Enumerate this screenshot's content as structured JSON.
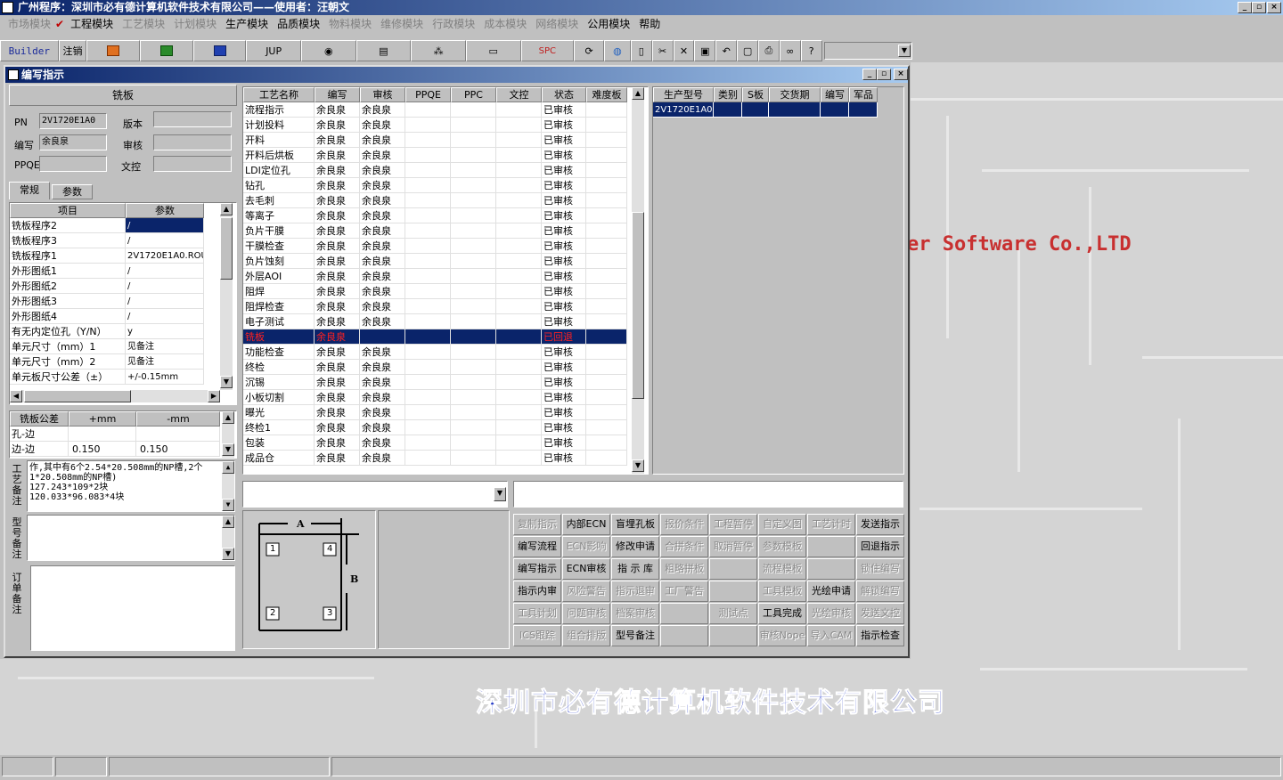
{
  "window": {
    "title": "广州程序：深圳市必有德计算机软件技术有限公司——使用者：汪朝文"
  },
  "menu": [
    {
      "label": "市场模块",
      "enabled": false
    },
    {
      "label": "工程模块",
      "enabled": true,
      "checked": true
    },
    {
      "label": "工艺模块",
      "enabled": false
    },
    {
      "label": "计划模块",
      "enabled": false
    },
    {
      "label": "生产模块",
      "enabled": true
    },
    {
      "label": "品质模块",
      "enabled": true
    },
    {
      "label": "物料模块",
      "enabled": false
    },
    {
      "label": "维修模块",
      "enabled": false
    },
    {
      "label": "行政模块",
      "enabled": false
    },
    {
      "label": "成本模块",
      "enabled": false
    },
    {
      "label": "网络模块",
      "enabled": false
    },
    {
      "label": "公用模块",
      "enabled": true
    },
    {
      "label": "帮助",
      "enabled": true
    }
  ],
  "toolbar": {
    "builder": "Builder",
    "logout": "注销",
    "jup": "JUP",
    "spc": "SPC"
  },
  "child": {
    "title": "编写指示"
  },
  "process": {
    "name": "铣板",
    "pn_label": "PN",
    "pn": "2V1720E1A0",
    "version_label": "版本",
    "version": "",
    "author_label": "编写",
    "author": "余良泉",
    "review_label": "审核",
    "review": "",
    "ppqe_label": "PPQE",
    "ppqe": "",
    "doc_label": "文控",
    "doc": ""
  },
  "tabs": [
    "常规",
    "参数"
  ],
  "params": {
    "headers": [
      "项目",
      "参数"
    ],
    "rows": [
      [
        "铣板程序2",
        "/"
      ],
      [
        "铣板程序3",
        "/"
      ],
      [
        "铣板程序1",
        "2V1720E1A0.ROU"
      ],
      [
        "外形图纸1",
        "/"
      ],
      [
        "外形图纸2",
        "/"
      ],
      [
        "外形图纸3",
        "/"
      ],
      [
        "外形图纸4",
        "/"
      ],
      [
        "有无内定位孔（Y/N）",
        "y"
      ],
      [
        "单元尺寸（mm）1",
        "见备注"
      ],
      [
        "单元尺寸（mm）2",
        "见备注"
      ],
      [
        "单元板尺寸公差（±）",
        "+/-0.15mm"
      ]
    ]
  },
  "tolerance": {
    "headers": [
      "铣板公差",
      "+mm",
      "-mm"
    ],
    "rows": [
      [
        "孔-边",
        "",
        ""
      ],
      [
        "边-边",
        "0.150",
        "0.150"
      ]
    ]
  },
  "notes": {
    "process_label": "工艺备注",
    "process_text": [
      "作,其中有6个2.54*20.508mm的NP槽,2个1*20.508mm的NP槽)",
      "127.243*109*2块",
      "120.033*96.083*4块"
    ],
    "model_label": "型号备注",
    "order_label": "订单备注"
  },
  "steps": {
    "headers": [
      "工艺名称",
      "编写",
      "审核",
      "PPQE",
      "PPC",
      "文控",
      "状态",
      "难度板"
    ],
    "rows": [
      [
        "流程指示",
        "余良泉",
        "余良泉",
        "",
        "",
        "",
        "已审核",
        ""
      ],
      [
        "计划投料",
        "余良泉",
        "余良泉",
        "",
        "",
        "",
        "已审核",
        ""
      ],
      [
        "开料",
        "余良泉",
        "余良泉",
        "",
        "",
        "",
        "已审核",
        ""
      ],
      [
        "开料后烘板",
        "余良泉",
        "余良泉",
        "",
        "",
        "",
        "已审核",
        ""
      ],
      [
        "LDI定位孔",
        "余良泉",
        "余良泉",
        "",
        "",
        "",
        "已审核",
        ""
      ],
      [
        "钻孔",
        "余良泉",
        "余良泉",
        "",
        "",
        "",
        "已审核",
        ""
      ],
      [
        "去毛刺",
        "余良泉",
        "余良泉",
        "",
        "",
        "",
        "已审核",
        ""
      ],
      [
        "等离子",
        "余良泉",
        "余良泉",
        "",
        "",
        "",
        "已审核",
        ""
      ],
      [
        "负片干膜",
        "余良泉",
        "余良泉",
        "",
        "",
        "",
        "已审核",
        ""
      ],
      [
        "干膜检查",
        "余良泉",
        "余良泉",
        "",
        "",
        "",
        "已审核",
        ""
      ],
      [
        "负片蚀刻",
        "余良泉",
        "余良泉",
        "",
        "",
        "",
        "已审核",
        ""
      ],
      [
        "外层AOI",
        "余良泉",
        "余良泉",
        "",
        "",
        "",
        "已审核",
        ""
      ],
      [
        "阻焊",
        "余良泉",
        "余良泉",
        "",
        "",
        "",
        "已审核",
        ""
      ],
      [
        "阻焊检查",
        "余良泉",
        "余良泉",
        "",
        "",
        "",
        "已审核",
        ""
      ],
      [
        "电子测试",
        "余良泉",
        "余良泉",
        "",
        "",
        "",
        "已审核",
        ""
      ],
      [
        "铣板",
        "余良泉",
        "",
        "",
        "",
        "",
        "已回退",
        ""
      ],
      [
        "功能检查",
        "余良泉",
        "余良泉",
        "",
        "",
        "",
        "已审核",
        ""
      ],
      [
        "终检",
        "余良泉",
        "余良泉",
        "",
        "",
        "",
        "已审核",
        ""
      ],
      [
        "沉锡",
        "余良泉",
        "余良泉",
        "",
        "",
        "",
        "已审核",
        ""
      ],
      [
        "小板切割",
        "余良泉",
        "余良泉",
        "",
        "",
        "",
        "已审核",
        ""
      ],
      [
        "曝光",
        "余良泉",
        "余良泉",
        "",
        "",
        "",
        "已审核",
        ""
      ],
      [
        "终检1",
        "余良泉",
        "余良泉",
        "",
        "",
        "",
        "已审核",
        ""
      ],
      [
        "包装",
        "余良泉",
        "余良泉",
        "",
        "",
        "",
        "已审核",
        ""
      ],
      [
        "成品仓",
        "余良泉",
        "余良泉",
        "",
        "",
        "",
        "已审核",
        ""
      ]
    ],
    "selected_index": 15
  },
  "models": {
    "headers": [
      "生产型号",
      "类别",
      "S板",
      "交货期",
      "编写",
      "军品"
    ],
    "rows": [
      [
        "2V1720E1A0",
        "",
        "",
        "",
        "",
        ""
      ]
    ]
  },
  "diagram": {
    "label_a": "A",
    "label_b": "B",
    "n1": "1",
    "n2": "2",
    "n3": "3",
    "n4": "4"
  },
  "actions": [
    {
      "label": "复制指示",
      "enabled": false
    },
    {
      "label": "内部ECN",
      "enabled": true
    },
    {
      "label": "盲埋孔板",
      "enabled": true
    },
    {
      "label": "报价条件",
      "enabled": false
    },
    {
      "label": "工程暂停",
      "enabled": false
    },
    {
      "label": "自定义图",
      "enabled": false
    },
    {
      "label": "工艺计时",
      "enabled": false
    },
    {
      "label": "发送指示",
      "enabled": true
    },
    {
      "label": "编写流程",
      "enabled": true
    },
    {
      "label": "ECN影响",
      "enabled": false
    },
    {
      "label": "修改申请",
      "enabled": true
    },
    {
      "label": "合拼条件",
      "enabled": false
    },
    {
      "label": "取消暂停",
      "enabled": false
    },
    {
      "label": "参数模板",
      "enabled": false
    },
    {
      "label": "",
      "enabled": false
    },
    {
      "label": "回退指示",
      "enabled": true
    },
    {
      "label": "编写指示",
      "enabled": true
    },
    {
      "label": "ECN审核",
      "enabled": true
    },
    {
      "label": "指 示 库",
      "enabled": true
    },
    {
      "label": "粗略拼板",
      "enabled": false
    },
    {
      "label": "",
      "enabled": false
    },
    {
      "label": "流程模板",
      "enabled": false
    },
    {
      "label": "",
      "enabled": false
    },
    {
      "label": "锁住编写",
      "enabled": false
    },
    {
      "label": "指示内审",
      "enabled": true
    },
    {
      "label": "风险警告",
      "enabled": false
    },
    {
      "label": "指示退审",
      "enabled": false
    },
    {
      "label": "工厂警告",
      "enabled": false
    },
    {
      "label": "",
      "enabled": false
    },
    {
      "label": "工具模板",
      "enabled": false
    },
    {
      "label": "光绘申请",
      "enabled": true
    },
    {
      "label": "解锁编写",
      "enabled": false
    },
    {
      "label": "工具计划",
      "enabled": false
    },
    {
      "label": "问题审核",
      "enabled": false
    },
    {
      "label": "档案审核",
      "enabled": false
    },
    {
      "label": "",
      "enabled": false
    },
    {
      "label": "测试点",
      "enabled": false
    },
    {
      "label": "工具完成",
      "enabled": true
    },
    {
      "label": "光绘审核",
      "enabled": false
    },
    {
      "label": "发送文控",
      "enabled": false
    },
    {
      "label": "ICS跟踪",
      "enabled": false
    },
    {
      "label": "组合排版",
      "enabled": false
    },
    {
      "label": "型号备注",
      "enabled": true
    },
    {
      "label": "",
      "enabled": false
    },
    {
      "label": "",
      "enabled": false
    },
    {
      "label": "审核Nope",
      "enabled": false
    },
    {
      "label": "导入CAM",
      "enabled": false
    },
    {
      "label": "指示检查",
      "enabled": true
    }
  ],
  "background": {
    "software_text": "er Software Co.,LTD",
    "company_text": "深圳市必有德计算机软件技术有限公司",
    "colors": {
      "software": "#c83030",
      "company": "#2a3ec8",
      "selection": "#0a246a",
      "titlebar": "#0a246a"
    }
  }
}
